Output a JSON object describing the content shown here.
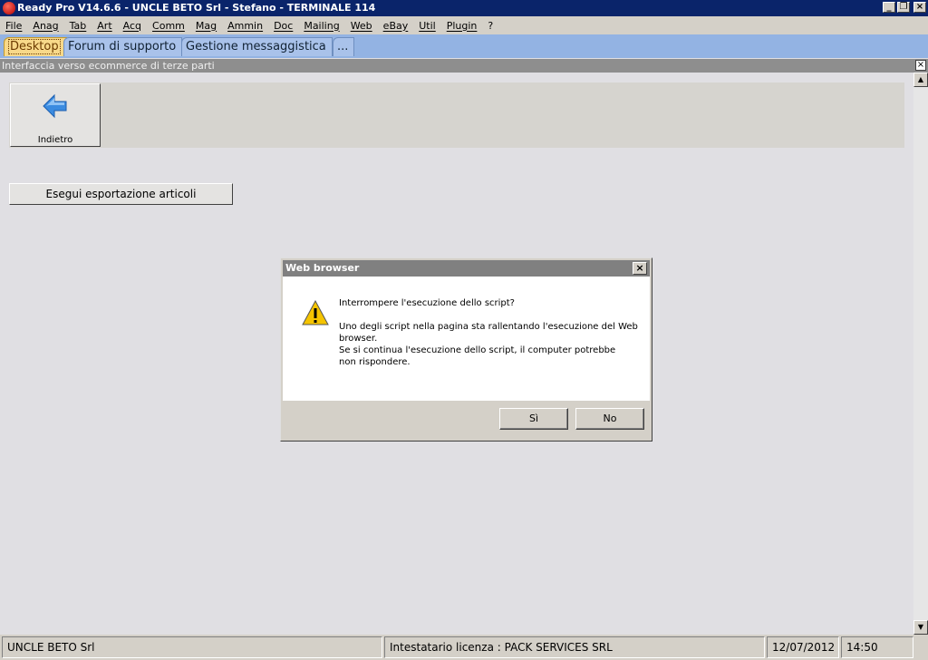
{
  "window": {
    "title": "Ready Pro V14.6.6 - UNCLE BETO Srl - Stefano - TERMINALE 114"
  },
  "menu": [
    "File",
    "Anag",
    "Tab",
    "Art",
    "Acq",
    "Comm",
    "Mag",
    "Ammin",
    "Doc",
    "Mailing",
    "Web",
    "eBay",
    "Util",
    "Plugin",
    "?"
  ],
  "tabs": [
    "Desktop",
    "Forum di supporto",
    "Gestione messaggistica",
    "..."
  ],
  "panel": {
    "title": "Interfaccia verso ecommerce di terze parti",
    "back_label": "Indietro",
    "export_label": "Esegui esportazione articoli"
  },
  "dialog": {
    "title": "Web browser",
    "question": "Interrompere l'esecuzione dello script?",
    "lines": [
      "Uno degli script nella pagina sta rallentando l'esecuzione del Web",
      "browser.",
      "Se si continua l'esecuzione dello script, il computer potrebbe",
      "non rispondere."
    ],
    "yes_label": "Sì",
    "no_label": "No"
  },
  "status": {
    "company": "UNCLE BETO Srl",
    "license": "Intestatario licenza : PACK SERVICES SRL",
    "date": "12/07/2012",
    "time": "14:50"
  },
  "colors": {
    "titlebar": "#0a246a",
    "tabstrip": "#93b3e3",
    "active_tab": "#f8d98a",
    "back_arrow": "#3a8be0",
    "warning": "#f5c400"
  }
}
